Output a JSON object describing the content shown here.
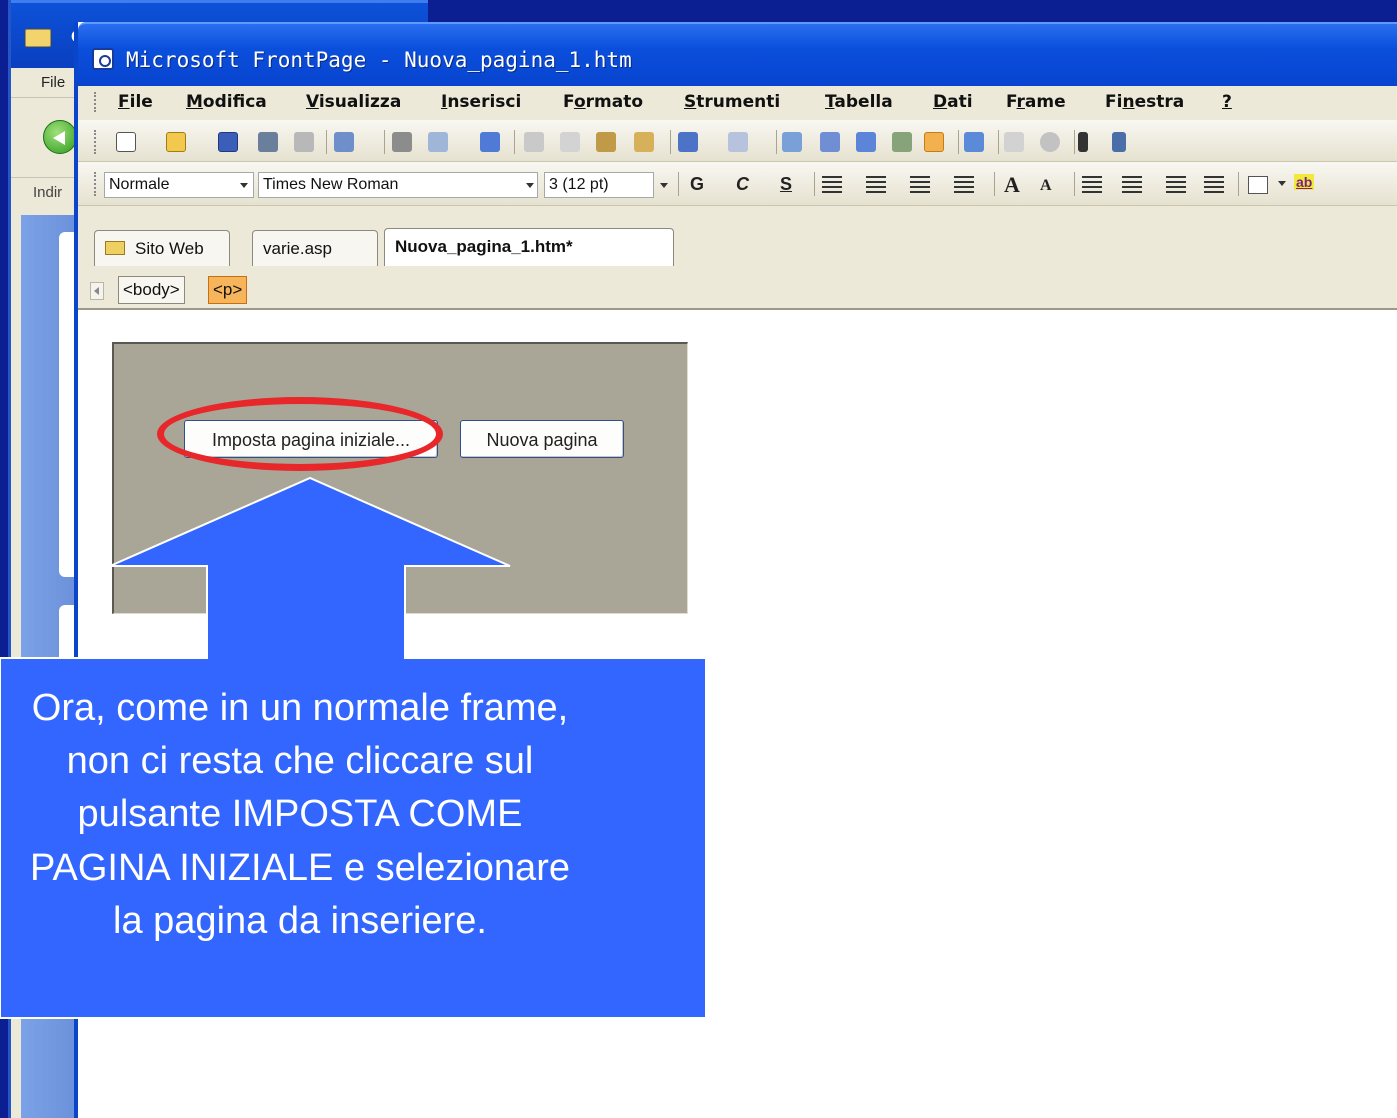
{
  "background_window": {
    "title_fragment": "C",
    "menu_file": "File",
    "address_label": "Indir"
  },
  "window": {
    "title": "Microsoft FrontPage - Nuova_pagina_1.htm"
  },
  "menubar": {
    "items": [
      {
        "underline": "F",
        "rest": "ile"
      },
      {
        "underline": "M",
        "rest": "odifica"
      },
      {
        "underline": "V",
        "rest": "isualizza"
      },
      {
        "underline": "I",
        "rest": "nserisci"
      },
      {
        "pre": "F",
        "underline": "o",
        "rest": "rmato"
      },
      {
        "underline": "S",
        "rest": "trumenti"
      },
      {
        "underline": "T",
        "rest": "abella"
      },
      {
        "underline": "D",
        "rest": "ati"
      },
      {
        "pre": "F",
        "underline": "r",
        "rest": "ame"
      },
      {
        "pre": "Fi",
        "underline": "n",
        "rest": "estra"
      },
      {
        "underline": "?",
        "rest": ""
      }
    ]
  },
  "format_toolbar": {
    "style_value": "Normale",
    "font_value": "Times New Roman",
    "size_value": "3 (12 pt)",
    "bold_label": "G",
    "italic_label": "C",
    "underline_label": "S",
    "highlight_label": "ab"
  },
  "tabs": [
    {
      "label": "Sito Web"
    },
    {
      "label": "varie.asp"
    },
    {
      "label": "Nuova_pagina_1.htm*"
    }
  ],
  "tag_selector": {
    "body_tag": "<body>",
    "p_tag": "<p>"
  },
  "frame": {
    "set_initial_page_button": "Imposta pagina iniziale...",
    "new_page_button": "Nuova pagina"
  },
  "callout": {
    "lines": [
      "Ora, come in un normale frame,",
      "non ci resta che cliccare sul",
      "pulsante IMPOSTA COME",
      "PAGINA INIZIALE e selezionare",
      "la pagina da inseriere."
    ],
    "arrow_color": "#3366ff",
    "highlight_color": "#e8272a"
  }
}
